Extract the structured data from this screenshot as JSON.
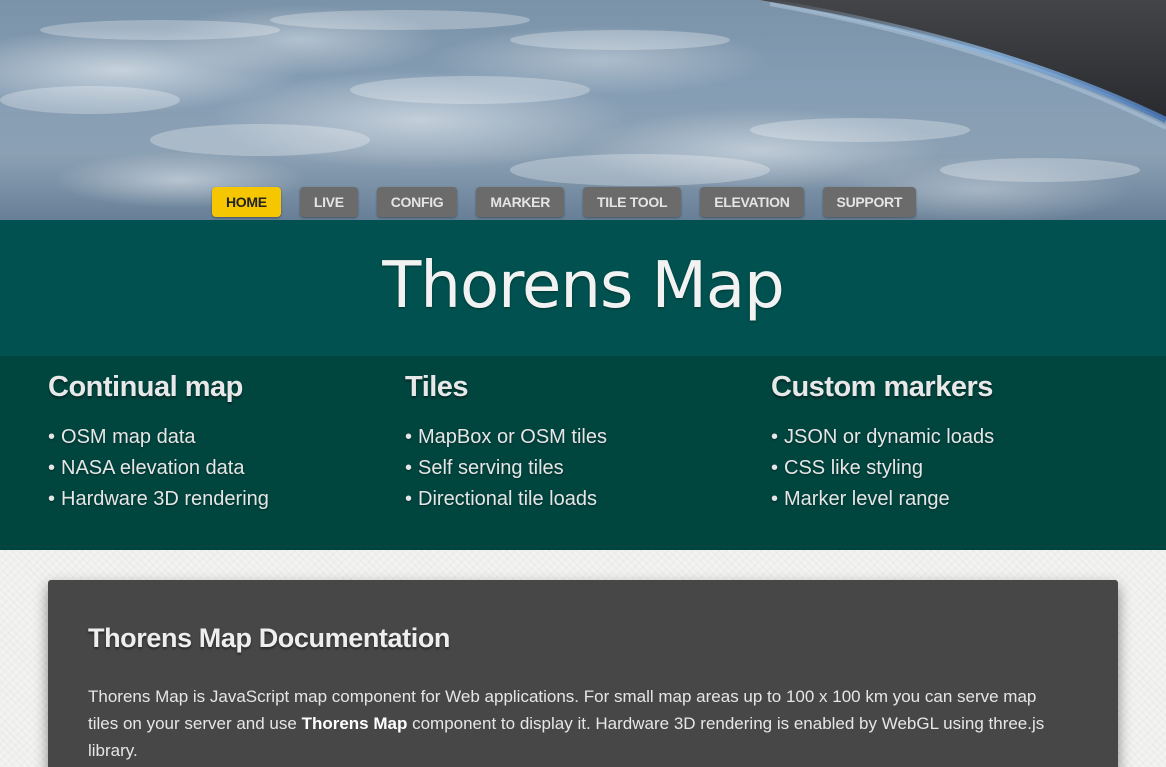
{
  "nav": {
    "items": [
      {
        "label": "HOME",
        "active": true
      },
      {
        "label": "LIVE",
        "active": false
      },
      {
        "label": "CONFIG",
        "active": false
      },
      {
        "label": "MARKER",
        "active": false
      },
      {
        "label": "TILE TOOL",
        "active": false
      },
      {
        "label": "ELEVATION",
        "active": false
      },
      {
        "label": "SUPPORT",
        "active": false
      }
    ],
    "active_color": "#f6c700",
    "inactive_color": "#6b6b6b"
  },
  "site": {
    "title": "Thorens Map"
  },
  "features": [
    {
      "heading": "Continual map",
      "items": [
        "OSM map data",
        "NASA elevation data",
        "Hardware 3D rendering"
      ]
    },
    {
      "heading": "Tiles",
      "items": [
        "MapBox or OSM tiles",
        "Self serving tiles",
        "Directional tile loads"
      ]
    },
    {
      "heading": "Custom markers",
      "items": [
        "JSON or dynamic loads",
        "CSS like styling",
        "Marker level range"
      ]
    }
  ],
  "doc": {
    "heading": "Thorens Map Documentation",
    "intro_part1": "Thorens Map is JavaScript map component for Web applications. For small map areas up to 100 x 100 km you can serve map tiles on your server and use ",
    "intro_bold": "Thorens Map",
    "intro_part2": " component to display it. Hardware 3D rendering is enabled by WebGL using three.js library."
  },
  "colors": {
    "title_band": "#00514f",
    "features_band": "#01453f",
    "doc_card": "#474747"
  }
}
